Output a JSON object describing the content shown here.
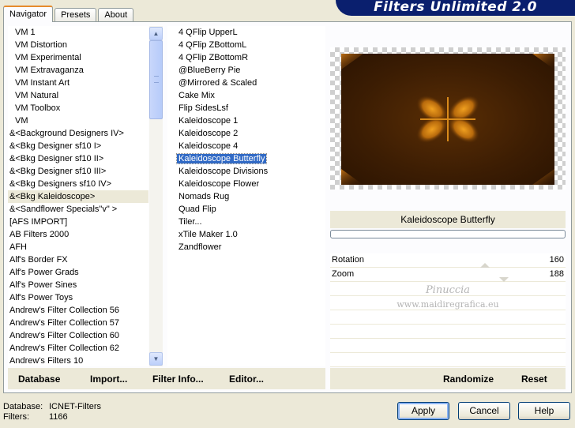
{
  "tabs": [
    {
      "label": "Navigator",
      "active": true
    },
    {
      "label": "Presets",
      "active": false
    },
    {
      "label": "About",
      "active": false
    }
  ],
  "banner": {
    "title": "Filters Unlimited 2.0"
  },
  "categories": [
    {
      "label": "VM 1",
      "indent": true
    },
    {
      "label": "VM Distortion",
      "indent": true
    },
    {
      "label": "VM Experimental",
      "indent": true
    },
    {
      "label": "VM Extravaganza",
      "indent": true
    },
    {
      "label": "VM Instant Art",
      "indent": true
    },
    {
      "label": "VM Natural",
      "indent": true
    },
    {
      "label": "VM Toolbox",
      "indent": true
    },
    {
      "label": "VM",
      "indent": true
    },
    {
      "label": "&<Background Designers IV>"
    },
    {
      "label": "&<Bkg Designer sf10 I>"
    },
    {
      "label": "&<Bkg Designer sf10 II>"
    },
    {
      "label": "&<Bkg Designer sf10 III>"
    },
    {
      "label": "&<Bkg Designers sf10 IV>"
    },
    {
      "label": "&<Bkg Kaleidoscope>",
      "selected": true
    },
    {
      "label": "&<Sandflower Specials\"v\" >"
    },
    {
      "label": "[AFS IMPORT]"
    },
    {
      "label": "AB Filters 2000"
    },
    {
      "label": "AFH"
    },
    {
      "label": "Alf's Border FX"
    },
    {
      "label": "Alf's Power Grads"
    },
    {
      "label": "Alf's Power Sines"
    },
    {
      "label": "Alf's Power Toys"
    },
    {
      "label": "Andrew's Filter Collection 56"
    },
    {
      "label": "Andrew's Filter Collection 57"
    },
    {
      "label": "Andrew's Filter Collection 60"
    },
    {
      "label": "Andrew's Filter Collection 62"
    },
    {
      "label": "Andrew's Filters 10"
    }
  ],
  "filters": [
    {
      "label": "4 QFlip UpperL"
    },
    {
      "label": "4 QFlip ZBottomL"
    },
    {
      "label": "4 QFlip ZBottomR"
    },
    {
      "label": "@BlueBerry Pie"
    },
    {
      "label": "@Mirrored & Scaled"
    },
    {
      "label": "Cake Mix"
    },
    {
      "label": "Flip SidesLsf"
    },
    {
      "label": "Kaleidoscope 1"
    },
    {
      "label": "Kaleidoscope 2"
    },
    {
      "label": "Kaleidoscope 4"
    },
    {
      "label": "Kaleidoscope Butterfly",
      "selected": true
    },
    {
      "label": "Kaleidoscope Divisions"
    },
    {
      "label": "Kaleidoscope Flower"
    },
    {
      "label": "Nomads Rug"
    },
    {
      "label": "Quad Flip"
    },
    {
      "label": "Tiler..."
    },
    {
      "label": "xTile Maker 1.0"
    },
    {
      "label": "Zandflower"
    }
  ],
  "left_buttons": {
    "database": "Database",
    "import": "Import...",
    "filter_info": "Filter Info...",
    "editor": "Editor..."
  },
  "preview": {
    "filter_name": "Kaleidoscope Butterfly"
  },
  "params": [
    {
      "name": "Rotation",
      "value": "160"
    },
    {
      "name": "Zoom",
      "value": "188"
    }
  ],
  "watermark": {
    "line1": "Pinuccia",
    "line2": "www.maidiregrafica.eu"
  },
  "right_buttons": {
    "randomize": "Randomize",
    "reset": "Reset"
  },
  "status": {
    "database_label": "Database:",
    "database_value": "ICNET-Filters",
    "filters_label": "Filters:",
    "filters_value": "1166"
  },
  "dialog_buttons": {
    "apply": "Apply",
    "cancel": "Cancel",
    "help": "Help"
  }
}
